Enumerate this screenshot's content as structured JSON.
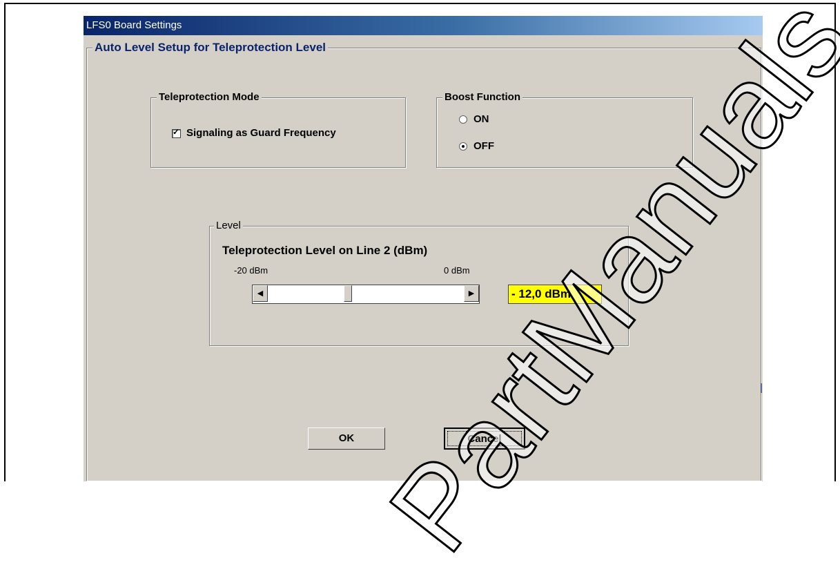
{
  "window": {
    "title": "LFS0 Board Settings"
  },
  "main_group": {
    "label": "Auto Level Setup for Teleprotection Level"
  },
  "teleprotection_mode": {
    "label": "Teleprotection Mode",
    "checkbox": {
      "label": "Signaling as Guard Frequency",
      "checked": true
    }
  },
  "boost_function": {
    "label": "Boost Function",
    "options": [
      {
        "label": "ON",
        "selected": false
      },
      {
        "label": "OFF",
        "selected": true
      }
    ]
  },
  "level": {
    "label": "Level",
    "heading": "Teleprotection Level on Line 2 (dBm)",
    "min_label": "-20 dBm",
    "max_label": "0 dBm",
    "value_display": "- 12,0 dBm",
    "value_color": "#ffff00"
  },
  "buttons": {
    "ok": "OK",
    "cancel": "Cancel"
  },
  "watermark": {
    "text": "PartManuals"
  }
}
